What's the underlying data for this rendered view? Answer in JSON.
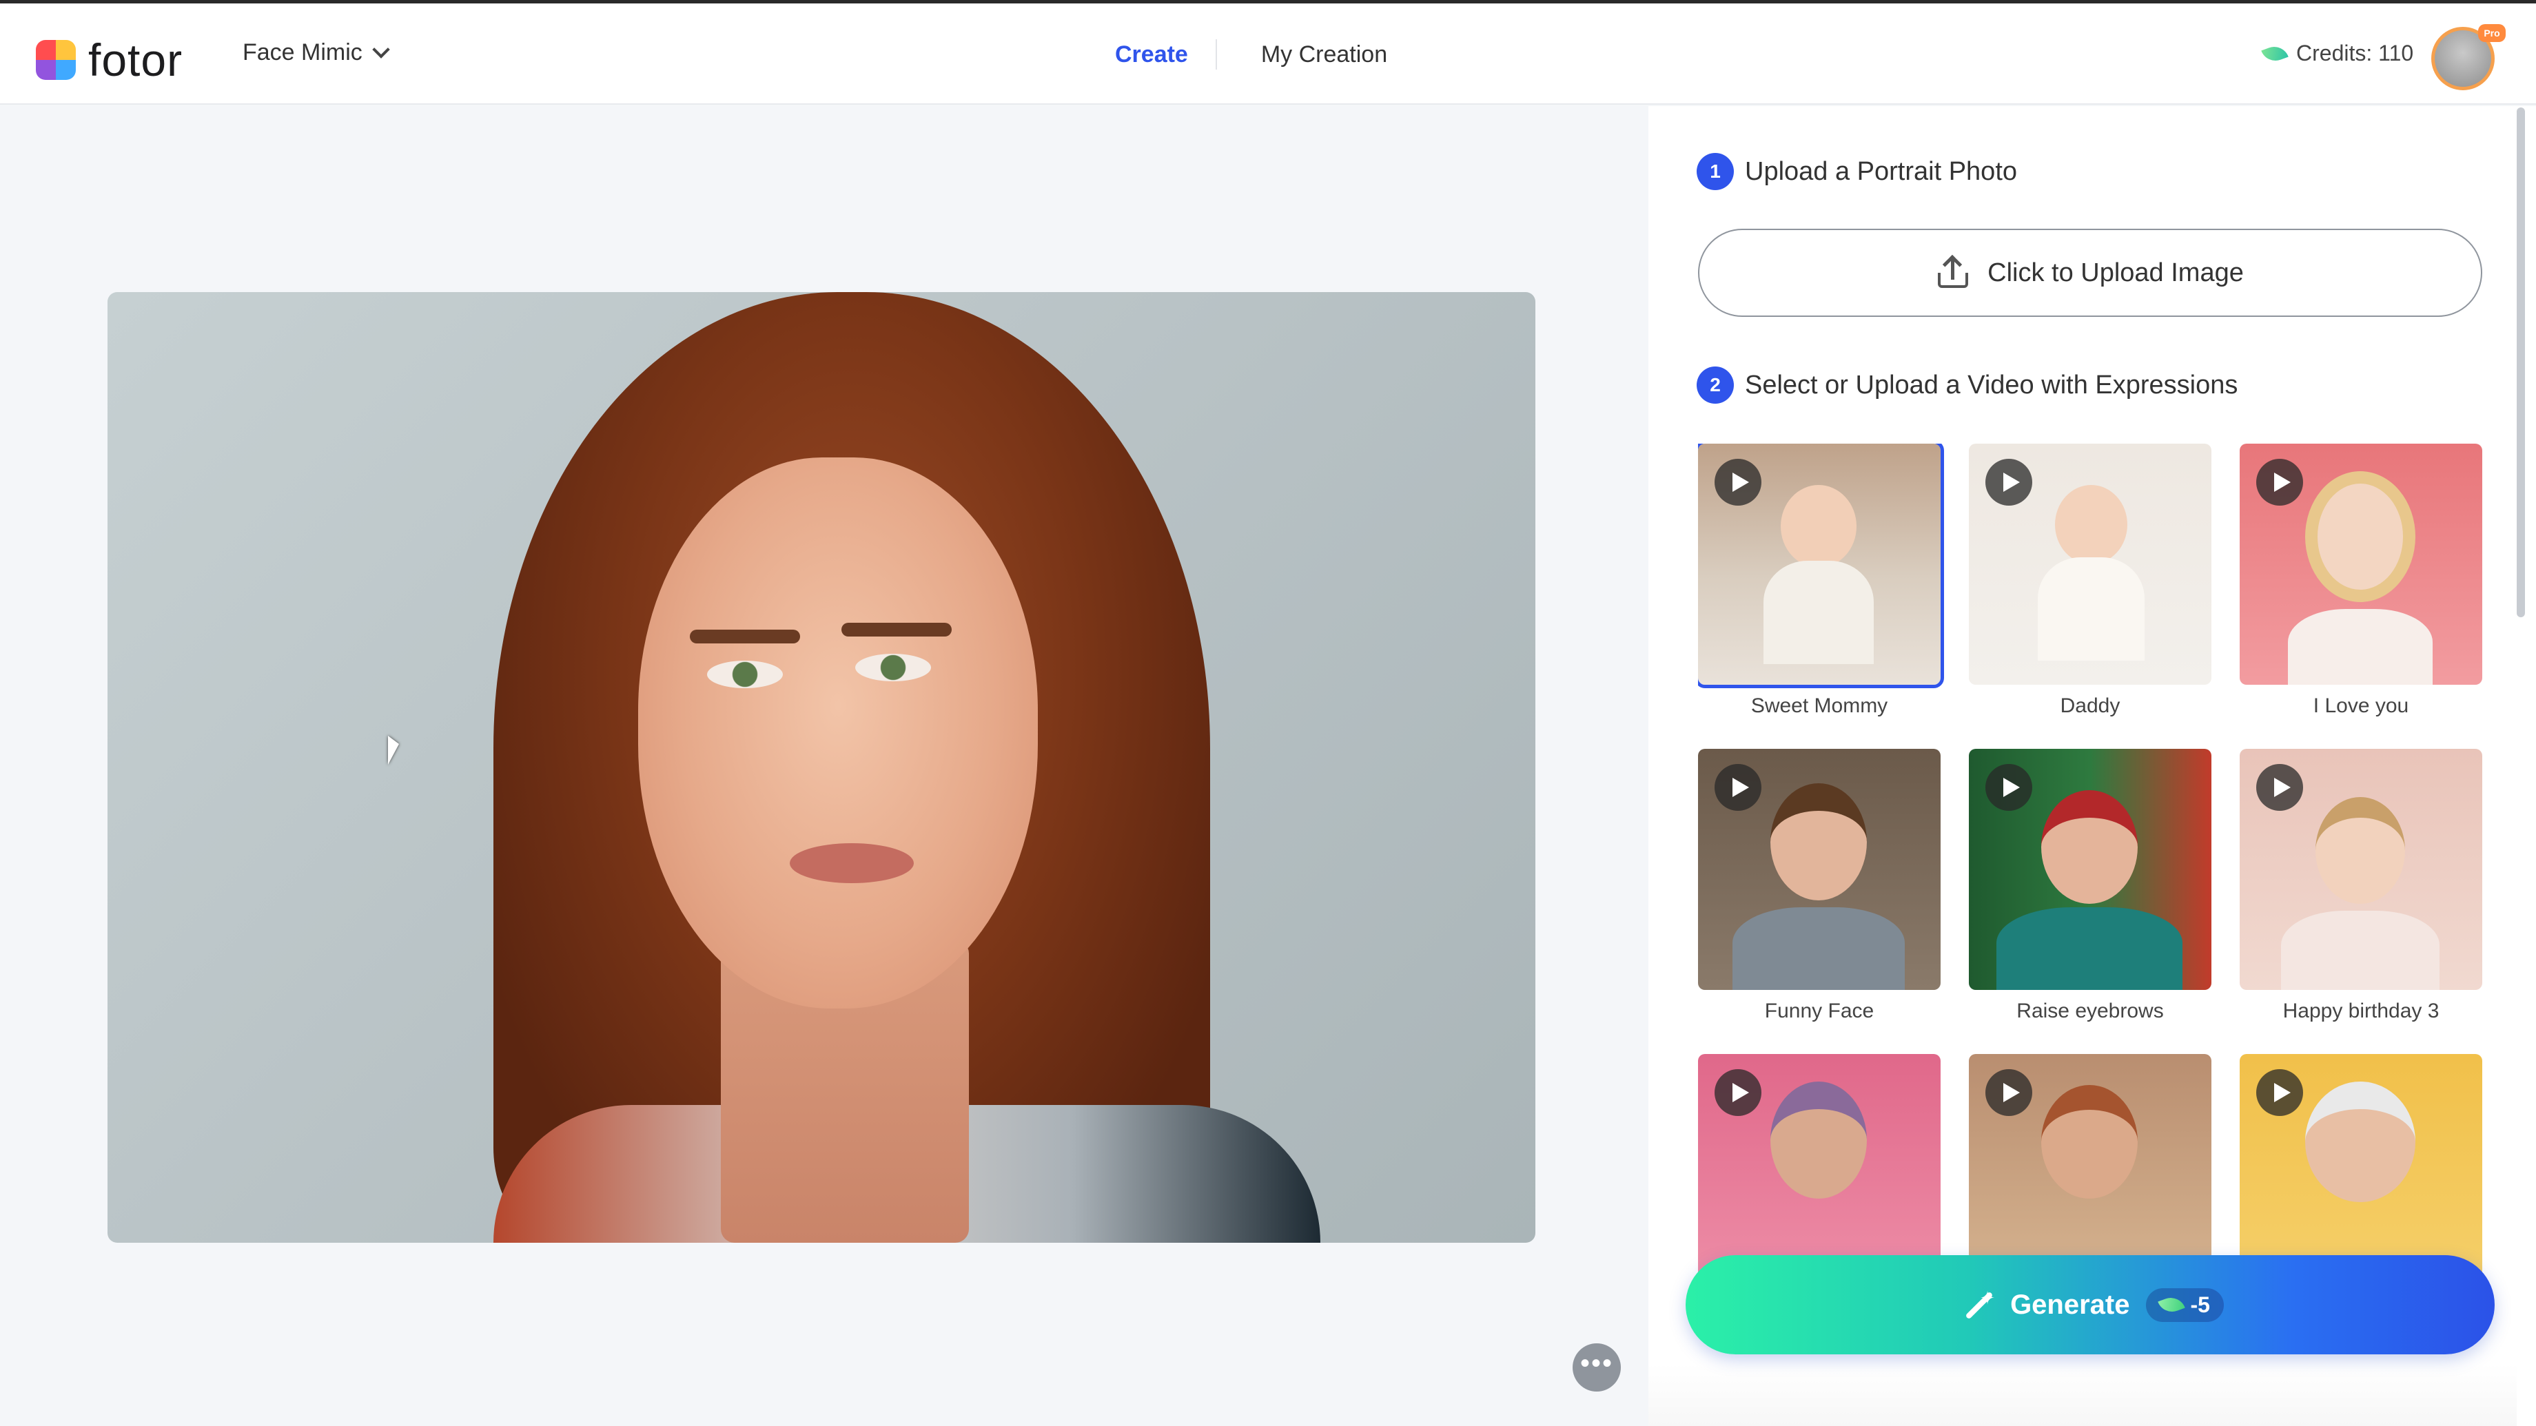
{
  "header": {
    "logo_text": "fotor",
    "tool_select": "Face Mimic",
    "nav": [
      {
        "label": "Create",
        "active": true
      },
      {
        "label": "My Creation",
        "active": false
      }
    ],
    "credits": "Credits: 110",
    "avatar_badge": "Pro"
  },
  "panel": {
    "step1": {
      "number": "1",
      "title": "Upload a Portrait Photo"
    },
    "upload_button": "Click to Upload Image",
    "step2": {
      "number": "2",
      "title": "Select or Upload a Video with Expressions"
    },
    "videos": [
      {
        "label": "Sweet Mommy",
        "selected": true
      },
      {
        "label": "Daddy",
        "selected": false
      },
      {
        "label": "I Love you",
        "selected": false
      },
      {
        "label": "Funny Face",
        "selected": false
      },
      {
        "label": "Raise eyebrows",
        "selected": false
      },
      {
        "label": "Happy birthday 3",
        "selected": false
      },
      {
        "label": "",
        "selected": false
      },
      {
        "label": "",
        "selected": false
      },
      {
        "label": "",
        "selected": false
      }
    ],
    "generate": {
      "label": "Generate",
      "cost": "-5"
    }
  },
  "colors": {
    "accent": "#2f54eb",
    "generate_start": "#2bf0a8",
    "generate_end": "#2b52e8"
  }
}
